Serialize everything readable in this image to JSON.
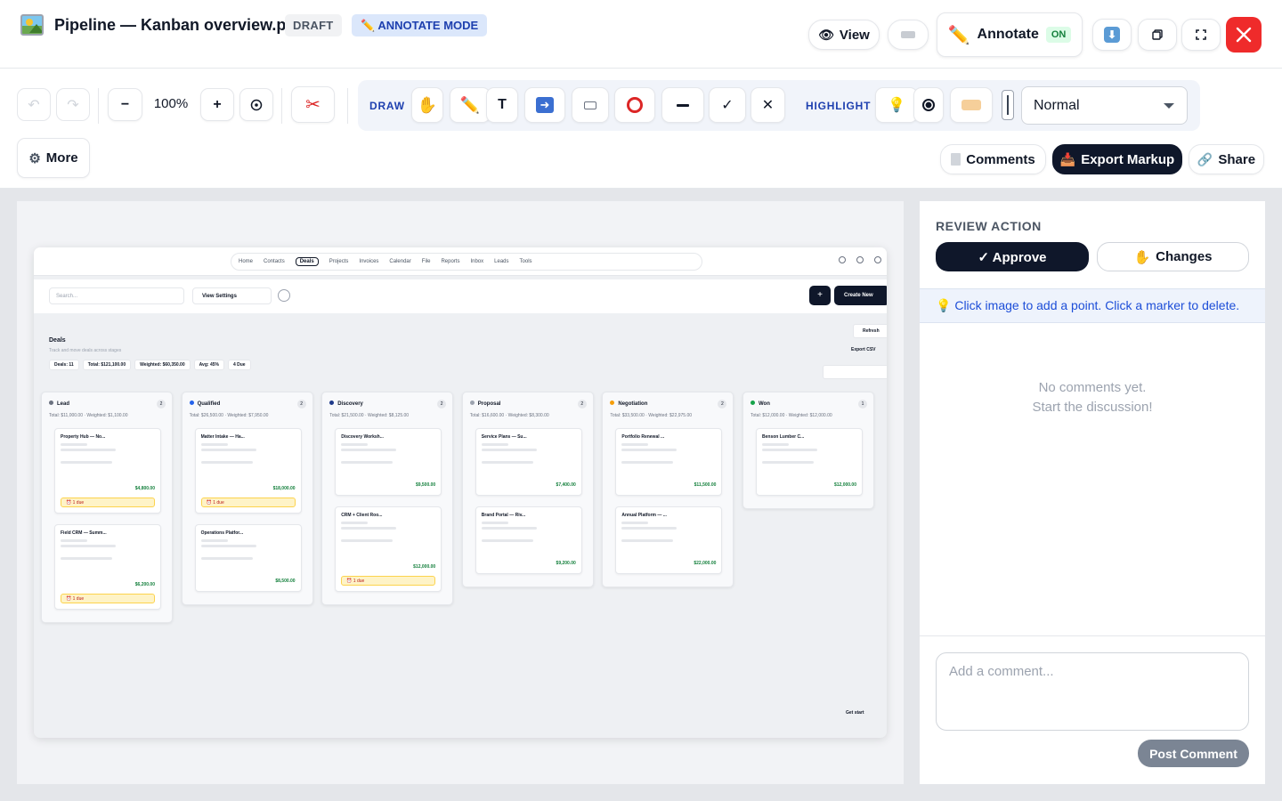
{
  "header": {
    "file_title": "Pipeline — Kanban overview.png",
    "draft_badge": "DRAFT",
    "annotate_badge": "✏️ ANNOTATE MODE",
    "view_label": "View",
    "annotate_label": "Annotate",
    "annotate_state": "ON"
  },
  "toolbar": {
    "zoom_level": "100%",
    "zoom_out_label": "−",
    "zoom_in_label": "+",
    "draw_label": "DRAW",
    "highlight_label": "HIGHLIGHT",
    "line_style_value": "Normal",
    "more_label": "More",
    "comments_label": "Comments",
    "export_label": "Export Markup",
    "share_label": "Share"
  },
  "screenshot": {
    "nav_items": [
      "Home",
      "Contacts",
      "Deals",
      "Projects",
      "Invoices",
      "Calendar",
      "File",
      "Reports",
      "Inbox",
      "Leads",
      "Tools"
    ],
    "active_nav": "Deals",
    "search_placeholder": "Search...",
    "view_settings": "View Settings",
    "create_new": "Create New",
    "page_title": "Deals",
    "page_subtitle": "Track and move deals across stages",
    "stats": [
      "Deals: 11",
      "Total: $121,100.00",
      "Weighted: $60,350.00",
      "Avg: 45%",
      "4 Due"
    ],
    "refresh": "Refresh",
    "export_csv": "Export CSV",
    "get_started": "Get start",
    "columns": [
      {
        "name": "Lead",
        "count": "2",
        "color": "#6b7280",
        "total": "Total: $11,000.00 · Weighted: $1,100.00",
        "cards": [
          {
            "title": "Property Hub — No...",
            "amount": "$4,800.00",
            "due": "1 due"
          },
          {
            "title": "Field CRM — Summ...",
            "amount": "$6,200.00",
            "due": "1 due"
          }
        ]
      },
      {
        "name": "Qualified",
        "count": "2",
        "color": "#2563eb",
        "total": "Total: $26,500.00 · Weighted: $7,950.00",
        "cards": [
          {
            "title": "Matter Intake — Ha...",
            "amount": "$18,000.00",
            "due": "1 due"
          },
          {
            "title": "Operations Platfor...",
            "amount": "$8,500.00",
            "due": ""
          }
        ]
      },
      {
        "name": "Discovery",
        "count": "2",
        "color": "#1e3a8a",
        "total": "Total: $21,500.00 · Weighted: $8,125.00",
        "cards": [
          {
            "title": "Discovery Worksh...",
            "amount": "$9,500.00",
            "due": ""
          },
          {
            "title": "CRM + Client Roo...",
            "amount": "$12,000.00",
            "due": "1 due"
          }
        ]
      },
      {
        "name": "Proposal",
        "count": "2",
        "color": "#9ca3af",
        "total": "Total: $16,600.00 · Weighted: $8,300.00",
        "cards": [
          {
            "title": "Service Plans — Su...",
            "amount": "$7,400.00",
            "due": ""
          },
          {
            "title": "Brand Portal — Riv...",
            "amount": "$9,200.00",
            "due": ""
          }
        ]
      },
      {
        "name": "Negotiation",
        "count": "2",
        "color": "#f59e0b",
        "total": "Total: $33,500.00 · Weighted: $22,975.00",
        "cards": [
          {
            "title": "Portfolio Renewal ...",
            "amount": "$11,500.00",
            "due": ""
          },
          {
            "title": "Annual Platform — ...",
            "amount": "$22,000.00",
            "due": ""
          }
        ]
      },
      {
        "name": "Won",
        "count": "1",
        "color": "#16a34a",
        "total": "Total: $12,000.00 · Weighted: $12,000.00",
        "cards": [
          {
            "title": "Benson Lumber C...",
            "amount": "$12,000.00",
            "due": ""
          }
        ]
      }
    ]
  },
  "review": {
    "title": "REVIEW ACTION",
    "approve_label": "✓ Approve",
    "changes_label": "Changes",
    "hint": "Click image to add a point. Click a marker to delete.",
    "empty_line1": "No comments yet.",
    "empty_line2": "Start the discussion!",
    "comment_placeholder": "Add a comment...",
    "post_label": "Post Comment"
  },
  "colors": {
    "close_button": "#ef2b2b",
    "primary_dark": "#0f172a",
    "accent_blue": "#1e40af",
    "success_green": "#15803d"
  }
}
